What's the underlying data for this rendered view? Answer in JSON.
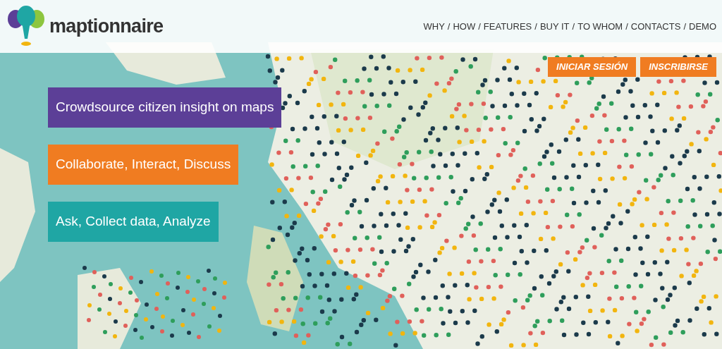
{
  "header": {
    "brand": "maptionnaire",
    "nav_separator": "/",
    "nav": [
      "WHY",
      "HOW",
      "FEATURES",
      "BUY IT",
      "TO WHOM",
      "CONTACTS",
      "DEMO"
    ]
  },
  "auth_buttons": [
    "INICIAR SESIÓN",
    "INSCRIBIRSE"
  ],
  "banners": [
    {
      "text": "Crowdsource citizen insight on maps",
      "color": "#5c3f97"
    },
    {
      "text": "Collaborate, Interact, Discuss",
      "color": "#f07c21"
    },
    {
      "text": "Ask, Collect data, Analyze",
      "color": "#1fa6a4"
    }
  ]
}
